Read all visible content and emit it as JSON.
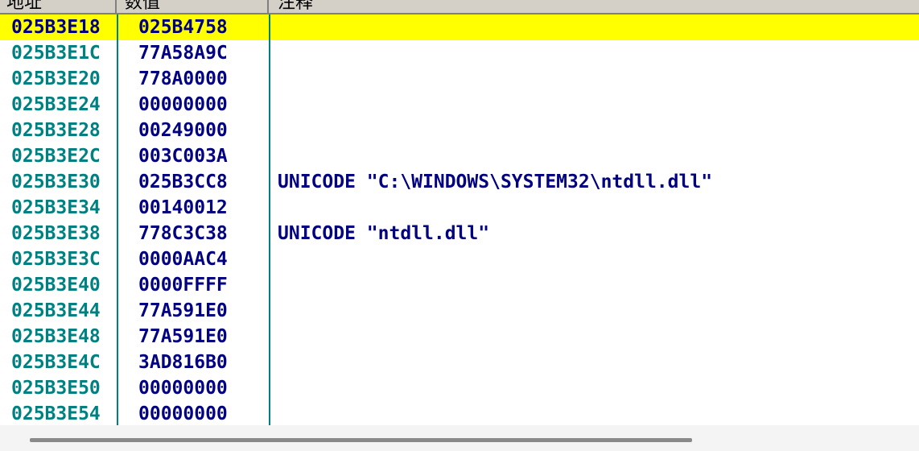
{
  "header": {
    "address_label": "地址",
    "value_label": "数值",
    "comment_label": "注释"
  },
  "colors": {
    "address_text": "#008080",
    "value_text": "#000080",
    "selected_row_bg": "#ffff00",
    "divider": "#008080"
  },
  "rows": [
    {
      "address": "025B3E18",
      "value": "025B4758",
      "comment": "",
      "selected": true
    },
    {
      "address": "025B3E1C",
      "value": "77A58A9C",
      "comment": ""
    },
    {
      "address": "025B3E20",
      "value": "778A0000",
      "comment": ""
    },
    {
      "address": "025B3E24",
      "value": "00000000",
      "comment": ""
    },
    {
      "address": "025B3E28",
      "value": "00249000",
      "comment": ""
    },
    {
      "address": "025B3E2C",
      "value": "003C003A",
      "comment": ""
    },
    {
      "address": "025B3E30",
      "value": "025B3CC8",
      "comment": "UNICODE \"C:\\WINDOWS\\SYSTEM32\\ntdll.dll\""
    },
    {
      "address": "025B3E34",
      "value": "00140012",
      "comment": ""
    },
    {
      "address": "025B3E38",
      "value": "778C3C38",
      "comment": "UNICODE \"ntdll.dll\""
    },
    {
      "address": "025B3E3C",
      "value": "0000AAC4",
      "comment": ""
    },
    {
      "address": "025B3E40",
      "value": "0000FFFF",
      "comment": ""
    },
    {
      "address": "025B3E44",
      "value": "77A591E0",
      "comment": ""
    },
    {
      "address": "025B3E48",
      "value": "77A591E0",
      "comment": ""
    },
    {
      "address": "025B3E4C",
      "value": "3AD816B0",
      "comment": ""
    },
    {
      "address": "025B3E50",
      "value": "00000000",
      "comment": ""
    },
    {
      "address": "025B3E54",
      "value": "00000000",
      "comment": ""
    }
  ]
}
